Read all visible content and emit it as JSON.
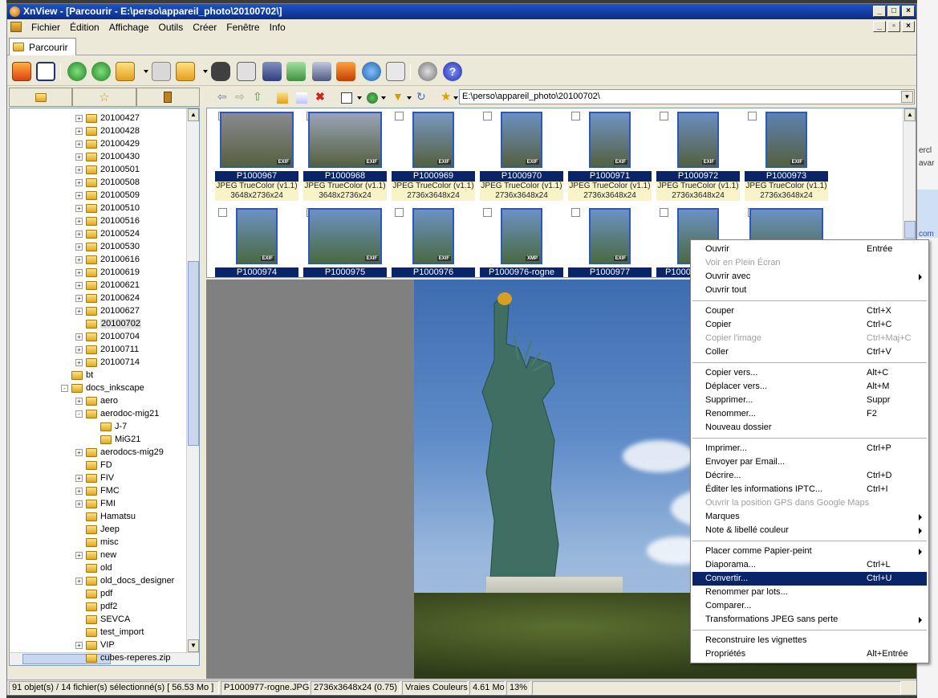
{
  "window": {
    "title": "XnView - [Parcourir - E:\\perso\\appareil_photo\\20100702\\]"
  },
  "menubar": [
    "Fichier",
    "Édition",
    "Affichage",
    "Outils",
    "Créer",
    "Fenêtre",
    "Info"
  ],
  "tab": {
    "label": "Parcourir"
  },
  "address": {
    "value": "E:\\perso\\appareil_photo\\20100702\\"
  },
  "tree": [
    {
      "label": "20100427",
      "exp": "+"
    },
    {
      "label": "20100428",
      "exp": "+"
    },
    {
      "label": "20100429",
      "exp": "+"
    },
    {
      "label": "20100430",
      "exp": "+"
    },
    {
      "label": "20100501",
      "exp": "+"
    },
    {
      "label": "20100508",
      "exp": "+"
    },
    {
      "label": "20100509",
      "exp": "+"
    },
    {
      "label": "20100510",
      "exp": "+"
    },
    {
      "label": "20100516",
      "exp": "+"
    },
    {
      "label": "20100524",
      "exp": "+"
    },
    {
      "label": "20100530",
      "exp": "+"
    },
    {
      "label": "20100616",
      "exp": "+"
    },
    {
      "label": "20100619",
      "exp": "+"
    },
    {
      "label": "20100621",
      "exp": "+"
    },
    {
      "label": "20100624",
      "exp": "+"
    },
    {
      "label": "20100627",
      "exp": "+"
    },
    {
      "label": "20100702",
      "exp": "",
      "selected": true
    },
    {
      "label": "20100704",
      "exp": "+"
    },
    {
      "label": "20100711",
      "exp": "+"
    },
    {
      "label": "20100714",
      "exp": "+"
    },
    {
      "label": "bt",
      "exp": ""
    },
    {
      "label": "docs_inkscape",
      "exp": "-"
    },
    {
      "label": "aero",
      "exp": "+"
    },
    {
      "label": "aerodoc-mig21",
      "exp": "-"
    },
    {
      "label": "J-7",
      "exp": ""
    },
    {
      "label": "MiG21",
      "exp": ""
    },
    {
      "label": "aerodocs-mig29",
      "exp": "+"
    },
    {
      "label": "FD",
      "exp": ""
    },
    {
      "label": "FIV",
      "exp": "+"
    },
    {
      "label": "FMC",
      "exp": "+"
    },
    {
      "label": "FMI",
      "exp": "+"
    },
    {
      "label": "Hamatsu",
      "exp": ""
    },
    {
      "label": "Jeep",
      "exp": ""
    },
    {
      "label": "misc",
      "exp": ""
    },
    {
      "label": "new",
      "exp": "+"
    },
    {
      "label": "old",
      "exp": ""
    },
    {
      "label": "old_docs_designer",
      "exp": "+"
    },
    {
      "label": "pdf",
      "exp": ""
    },
    {
      "label": "pdf2",
      "exp": ""
    },
    {
      "label": "SEVCA",
      "exp": ""
    },
    {
      "label": "test_import",
      "exp": ""
    },
    {
      "label": "VIP",
      "exp": "+"
    },
    {
      "label": "cubes-reperes.zip",
      "exp": ""
    }
  ],
  "thumbnails_row1": [
    {
      "name": "P1000967",
      "format": "JPEG TrueColor (v1.1)",
      "dims": "3648x2736x24"
    },
    {
      "name": "P1000968",
      "format": "JPEG TrueColor (v1.1)",
      "dims": "3648x2736x24"
    },
    {
      "name": "P1000969",
      "format": "JPEG TrueColor (v1.1)",
      "dims": "2736x3648x24"
    },
    {
      "name": "P1000970",
      "format": "JPEG TrueColor (v1.1)",
      "dims": "2736x3648x24"
    },
    {
      "name": "P1000971",
      "format": "JPEG TrueColor (v1.1)",
      "dims": "2736x3648x24"
    },
    {
      "name": "P1000972",
      "format": "JPEG TrueColor (v1.1)",
      "dims": "2736x3648x24"
    },
    {
      "name": "P1000973",
      "format": "JPEG TrueColor (v1.1)",
      "dims": "2736x3648x24"
    }
  ],
  "thumbnails_row2": [
    {
      "name": "P1000974"
    },
    {
      "name": "P1000975"
    },
    {
      "name": "P1000976"
    },
    {
      "name": "P1000976-rogne"
    },
    {
      "name": "P1000977"
    },
    {
      "name": "P1000977-rogne"
    },
    {
      "name": ""
    }
  ],
  "badge": "EXIF",
  "badge_xmp": "XMP",
  "context_menu": [
    {
      "label": "Ouvrir",
      "shortcut": "Entrée"
    },
    {
      "label": "Voir en Plein Écran",
      "disabled": true
    },
    {
      "label": "Ouvrir avec",
      "submenu": true
    },
    {
      "label": "Ouvrir tout"
    },
    {
      "sep": true
    },
    {
      "label": "Couper",
      "shortcut": "Ctrl+X"
    },
    {
      "label": "Copier",
      "shortcut": "Ctrl+C"
    },
    {
      "label": "Copier l'image",
      "shortcut": "Ctrl+Maj+C",
      "disabled": true
    },
    {
      "label": "Coller",
      "shortcut": "Ctrl+V"
    },
    {
      "sep": true
    },
    {
      "label": "Copier vers...",
      "shortcut": "Alt+C"
    },
    {
      "label": "Déplacer vers...",
      "shortcut": "Alt+M"
    },
    {
      "label": "Supprimer...",
      "shortcut": "Suppr"
    },
    {
      "label": "Renommer...",
      "shortcut": "F2"
    },
    {
      "label": "Nouveau dossier"
    },
    {
      "sep": true
    },
    {
      "label": "Imprimer...",
      "shortcut": "Ctrl+P"
    },
    {
      "label": "Envoyer par Email..."
    },
    {
      "label": "Décrire...",
      "shortcut": "Ctrl+D"
    },
    {
      "label": "Éditer les informations IPTC...",
      "shortcut": "Ctrl+I"
    },
    {
      "label": "Ouvrir la position GPS dans Google Maps",
      "disabled": true
    },
    {
      "label": "Marques",
      "submenu": true
    },
    {
      "label": "Note & libellé couleur",
      "submenu": true
    },
    {
      "sep": true
    },
    {
      "label": "Placer comme Papier-peint",
      "submenu": true
    },
    {
      "label": "Diaporama...",
      "shortcut": "Ctrl+L"
    },
    {
      "label": "Convertir...",
      "shortcut": "Ctrl+U",
      "highlight": true
    },
    {
      "label": "Renommer par lots..."
    },
    {
      "label": "Comparer..."
    },
    {
      "label": "Transformations JPEG sans perte",
      "submenu": true
    },
    {
      "sep": true
    },
    {
      "label": "Reconstruire les vignettes"
    },
    {
      "label": "Propriétés",
      "shortcut": "Alt+Entrée"
    }
  ],
  "status": {
    "count": "91 objet(s) / 14 fichier(s) sélectionné(s)  [ 56.53 Mo ]",
    "file": "P1000977-rogne.JPG",
    "dims": "2736x3648x24 (0.75)",
    "colors": "Vraies Couleurs",
    "size": "4.61 Mo",
    "zoom": "13%"
  },
  "desktop_right": [
    "ercl",
    "avar",
    "com"
  ]
}
